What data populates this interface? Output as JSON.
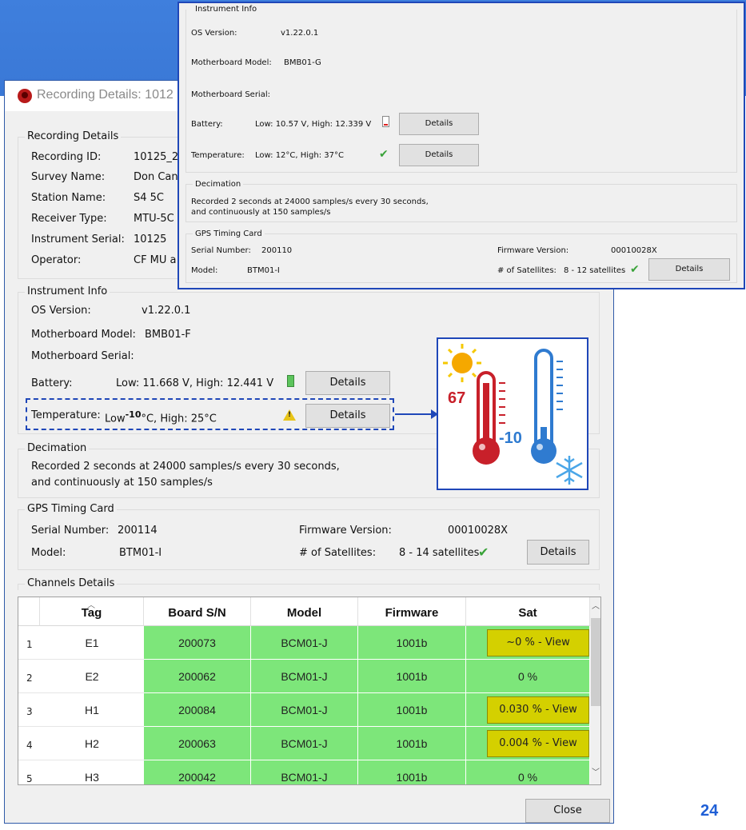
{
  "slide_number": "24",
  "dialog": {
    "title": "Recording Details: 1012",
    "recording_details": {
      "label": "Recording Details",
      "rows": [
        {
          "key": "Recording ID:",
          "value": "10125_2"
        },
        {
          "key": "Survey Name:",
          "value": "Don Can"
        },
        {
          "key": "Station Name:",
          "value": "S4 5C"
        },
        {
          "key": "Receiver Type:",
          "value": "MTU-5C"
        },
        {
          "key": "Instrument Serial:",
          "value": "10125"
        },
        {
          "key": "Operator:",
          "value": "CF MU a"
        }
      ]
    },
    "instrument_info": {
      "label": "Instrument Info",
      "os_label": "OS Version:",
      "os_value": "v1.22.0.1",
      "mb_model_label": "Motherboard Model:",
      "mb_model_value": "BMB01-F",
      "mb_serial_label": "Motherboard Serial:",
      "battery_label": "Battery:",
      "battery_value": "Low: 11.668 V, High: 12.441 V",
      "temp_label": "Temperature:",
      "temp_low": "Low",
      "temp_low_sup": "-10",
      "temp_rest": "°C, High: 25°C",
      "details_label": "Details"
    },
    "decimation": {
      "label": "Decimation",
      "line1": "Recorded 2 seconds at 24000 samples/s every 30 seconds,",
      "line2": "and continuously at 150 samples/s"
    },
    "gps": {
      "label": "GPS Timing Card",
      "serial_label": "Serial Number:",
      "serial_value": "200114",
      "model_label": "Model:",
      "model_value": "BTM01-I",
      "fw_label": "Firmware Version:",
      "fw_value": "00010028X",
      "sat_label": "# of Satellites:",
      "sat_value": "8 - 14 satellites",
      "details_label": "Details"
    },
    "channels": {
      "label": "Channels Details",
      "headers": [
        "Tag",
        "Board S/N",
        "Model",
        "Firmware",
        "Sat"
      ],
      "rows": [
        {
          "num": "1",
          "tag": "E1",
          "sn": "200073",
          "model": "BCM01-J",
          "fw": "1001b",
          "sat": "~0 % - View",
          "sat_button": true
        },
        {
          "num": "2",
          "tag": "E2",
          "sn": "200062",
          "model": "BCM01-J",
          "fw": "1001b",
          "sat": "0 %",
          "sat_button": false
        },
        {
          "num": "3",
          "tag": "H1",
          "sn": "200084",
          "model": "BCM01-J",
          "fw": "1001b",
          "sat": "0.030 % - View",
          "sat_button": true
        },
        {
          "num": "4",
          "tag": "H2",
          "sn": "200063",
          "model": "BCM01-J",
          "fw": "1001b",
          "sat": "0.004 % - View",
          "sat_button": true
        },
        {
          "num": "5",
          "tag": "H3",
          "sn": "200042",
          "model": "BCM01-J",
          "fw": "1001b",
          "sat": "0 %",
          "sat_button": false
        }
      ]
    },
    "close_label": "Close"
  },
  "overlay": {
    "instrument_info": {
      "label": "Instrument Info",
      "os_label": "OS Version:",
      "os_value": "v1.22.0.1",
      "mb_model_label": "Motherboard Model:",
      "mb_model_value": "BMB01-G",
      "mb_serial_label": "Motherboard Serial:",
      "battery_label": "Battery:",
      "battery_value": "Low: 10.57 V, High: 12.339 V",
      "temp_label": "Temperature:",
      "temp_value": "Low: 12°C, High: 37°C",
      "details_label": "Details"
    },
    "decimation": {
      "label": "Decimation",
      "line1": "Recorded 2 seconds at 24000 samples/s every 30 seconds,",
      "line2": "and continuously at 150 samples/s"
    },
    "gps": {
      "label": "GPS Timing Card",
      "serial_label": "Serial Number:",
      "serial_value": "200110",
      "model_label": "Model:",
      "model_value": "BTM01-I",
      "fw_label": "Firmware Version:",
      "fw_value": "00010028X",
      "sat_label": "# of Satellites:",
      "sat_value": "8 - 12 satellites",
      "details_label": "Details"
    }
  },
  "thermometer": {
    "hot_value": "67",
    "cold_value": "-10",
    "hot_color": "#c8202a",
    "cold_color": "#2f7bd0"
  },
  "colors": {
    "accent_border": "#1f47b8",
    "cell_green": "#7de67a",
    "sat_yellow": "#d4d000",
    "check_green": "#3aa33a"
  }
}
